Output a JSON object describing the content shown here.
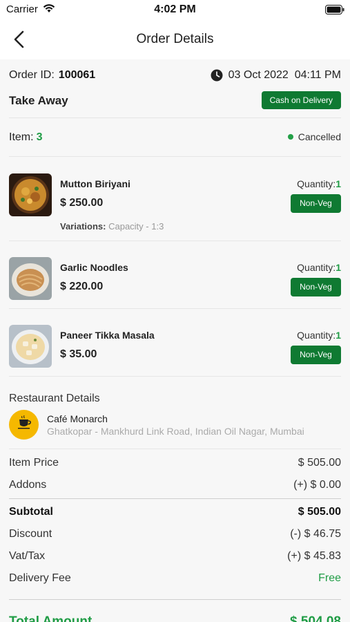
{
  "status_bar": {
    "carrier": "Carrier",
    "time": "4:02 PM"
  },
  "nav": {
    "title": "Order Details"
  },
  "order": {
    "id_label": "Order ID:",
    "id_value": "100061",
    "date": "03 Oct 2022  04:11 PM",
    "type": "Take Away",
    "payment": "Cash on Delivery",
    "item_label": "Item:",
    "item_count": "3",
    "status": "Cancelled"
  },
  "items": [
    {
      "name": "Mutton Biriyani",
      "price": "$ 250.00",
      "qty_label": "Quantity:",
      "qty": "1",
      "type": "Non-Veg",
      "variation_label": "Variations:",
      "variation": "Capacity - 1:3"
    },
    {
      "name": "Garlic Noodles",
      "price": "$ 220.00",
      "qty_label": "Quantity:",
      "qty": "1",
      "type": "Non-Veg"
    },
    {
      "name": "Paneer Tikka Masala",
      "price": "$ 35.00",
      "qty_label": "Quantity:",
      "qty": "1",
      "type": "Non-Veg"
    }
  ],
  "restaurant": {
    "section_title": "Restaurant Details",
    "name": "Café Monarch",
    "address": "Ghatkopar - Mankhurd Link Road, Indian Oil Nagar, Mumbai"
  },
  "summary": {
    "item_price_label": "Item Price",
    "item_price": "$ 505.00",
    "addons_label": "Addons",
    "addons": "(+) $ 0.00",
    "subtotal_label": "Subtotal",
    "subtotal": "$ 505.00",
    "discount_label": "Discount",
    "discount": "(-) $ 46.75",
    "tax_label": "Vat/Tax",
    "tax": "(+) $ 45.83",
    "delivery_label": "Delivery Fee",
    "delivery": "Free",
    "total_label": "Total Amount",
    "total": "$ 504.08"
  },
  "colors": {
    "accent_green": "#0f7a32",
    "text_green": "#1f9c45",
    "logo_yellow": "#f5b800"
  }
}
